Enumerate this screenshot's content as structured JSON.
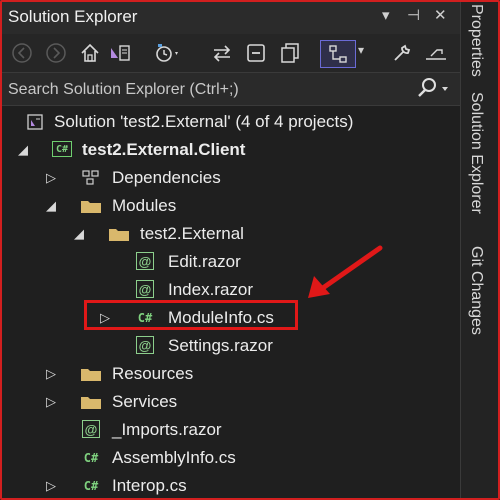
{
  "window": {
    "title": "Solution Explorer"
  },
  "titlebar_controls": {
    "dropdown": "▾",
    "pin": "⊣",
    "close": "✕"
  },
  "search": {
    "placeholder": "Search Solution Explorer (Ctrl+;)"
  },
  "tree": {
    "solution": "Solution 'test2.External' (4 of 4 projects)",
    "project": "test2.External.Client",
    "dependencies": "Dependencies",
    "modules": "Modules",
    "modules_sub": "test2.External",
    "edit": "Edit.razor",
    "index": "Index.razor",
    "moduleinfo": "ModuleInfo.cs",
    "settings": "Settings.razor",
    "resources": "Resources",
    "services": "Services",
    "imports": "_Imports.razor",
    "assemblyinfo": "AssemblyInfo.cs",
    "interop": "Interop.cs"
  },
  "side_tabs": {
    "properties": "Properties",
    "solution_explorer": "Solution Explorer",
    "git_changes": "Git Changes"
  },
  "icons": {
    "cs_tag": "C#",
    "razor_tag": "@"
  },
  "colors": {
    "highlight_red": "#e01818",
    "folder": "#d9b86c",
    "cs": "#7fd17f"
  }
}
